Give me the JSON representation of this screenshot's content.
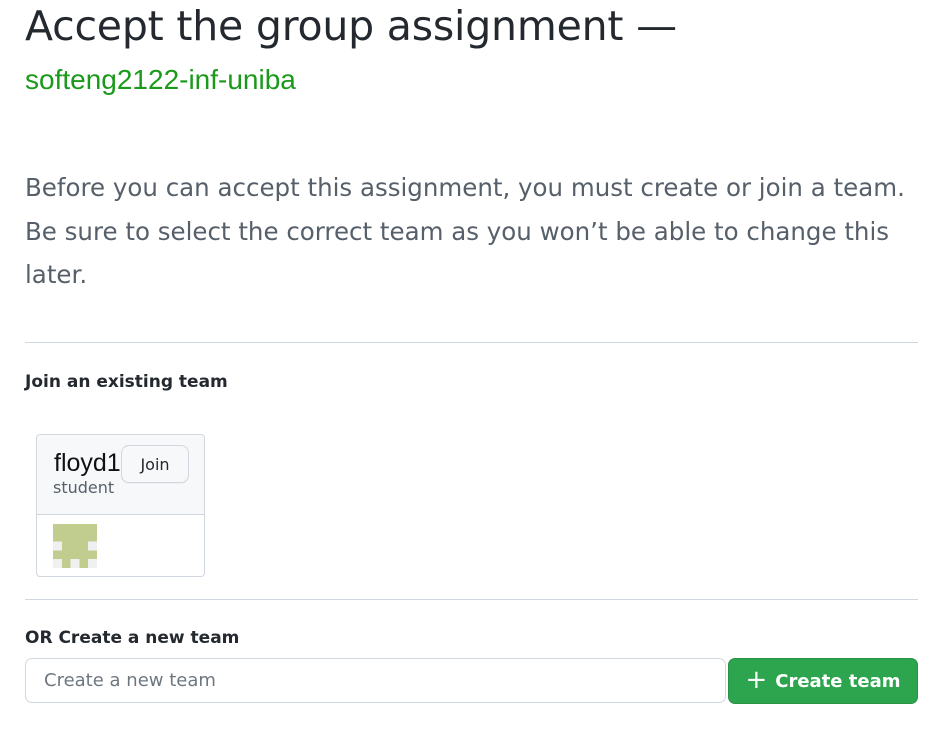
{
  "header": {
    "title": "Accept the group assignment —",
    "organization": "softeng2122-inf-uniba"
  },
  "intro_text": "Before you can accept this assignment, you must create or join a team. Be sure to select the correct team as you won’t be able to change this later.",
  "join_section": {
    "label": "Join an existing team",
    "teams": [
      {
        "name": "floyd1",
        "role": "student",
        "join_label": "Join",
        "avatar_icon": "identicon-avatar"
      }
    ]
  },
  "create_section": {
    "label": "OR Create a new team",
    "input_placeholder": "Create a new team",
    "input_value": "",
    "button_label": "Create team",
    "button_icon": "plus-icon"
  },
  "colors": {
    "org_green": "#1a9a1a",
    "button_green": "#2da44e",
    "avatar_green": "#c1cd8e"
  }
}
